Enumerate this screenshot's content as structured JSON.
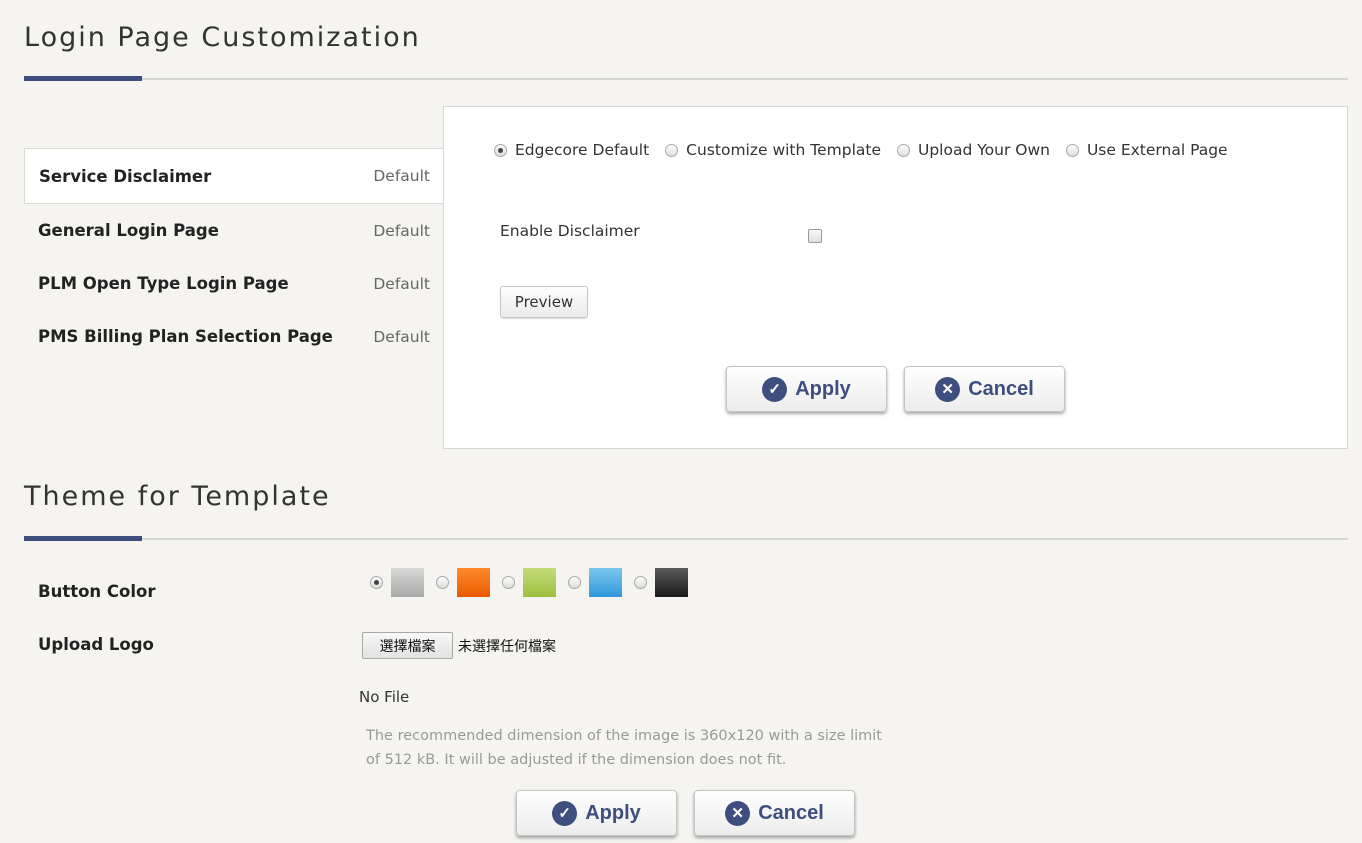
{
  "login_section": {
    "title": "Login Page Customization",
    "menu": [
      {
        "label": "Service Disclaimer",
        "status": "Default",
        "active": true
      },
      {
        "label": "General Login Page",
        "status": "Default",
        "active": false
      },
      {
        "label": "PLM Open Type Login Page",
        "status": "Default",
        "active": false
      },
      {
        "label": "PMS Billing Plan Selection Page",
        "status": "Default",
        "active": false
      }
    ],
    "panel": {
      "options": [
        {
          "label": "Edgecore Default",
          "checked": true
        },
        {
          "label": "Customize with Template",
          "checked": false
        },
        {
          "label": "Upload Your Own",
          "checked": false
        },
        {
          "label": "Use External Page",
          "checked": false
        }
      ],
      "enable_disclaimer_label": "Enable Disclaimer",
      "enable_disclaimer_checked": false,
      "preview_label": "Preview",
      "apply_label": "Apply",
      "cancel_label": "Cancel"
    }
  },
  "theme_section": {
    "title": "Theme for Template",
    "button_color_label": "Button Color",
    "colors": [
      {
        "name": "gray",
        "top": "#d8d8d8",
        "bottom": "#a9a9a9",
        "checked": true
      },
      {
        "name": "orange",
        "top": "#ff8a2a",
        "bottom": "#e85a00",
        "checked": false
      },
      {
        "name": "green",
        "top": "#c5dc7c",
        "bottom": "#9cbf3e",
        "checked": false
      },
      {
        "name": "blue",
        "top": "#7cc6ef",
        "bottom": "#2f98d8",
        "checked": false
      },
      {
        "name": "black",
        "top": "#5a5a5a",
        "bottom": "#1a1a1a",
        "checked": false
      }
    ],
    "upload_logo_label": "Upload Logo",
    "choose_file_label": "選擇檔案",
    "no_file_chosen": "未選擇任何檔案",
    "no_file": "No File",
    "hint": "The recommended dimension of the image is 360x120 with a size limit of 512 kB. It will be adjusted if the dimension does not fit.",
    "apply_label": "Apply",
    "cancel_label": "Cancel"
  },
  "colors": {
    "accent": "#3e4f7f"
  },
  "icons": {
    "apply": "check-circle-icon",
    "cancel": "x-circle-icon"
  }
}
